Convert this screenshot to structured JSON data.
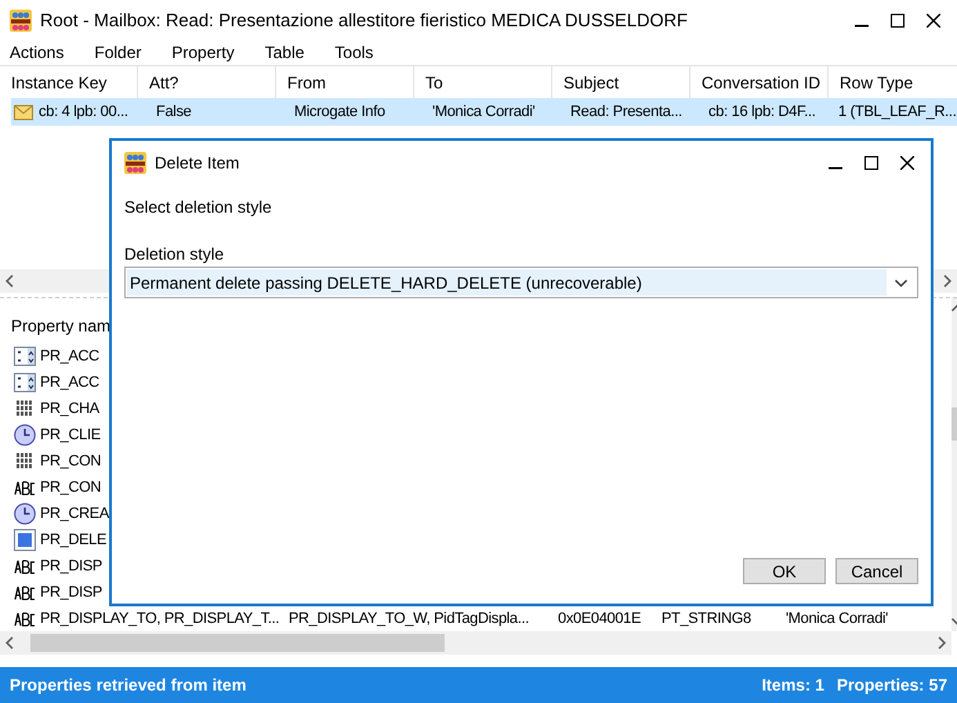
{
  "window": {
    "title": "Root - Mailbox: Read: Presentazione allestitore fieristico MEDICA DUSSELDORF"
  },
  "menu": [
    "Actions",
    "Folder",
    "Property",
    "Table",
    "Tools"
  ],
  "table": {
    "columns": [
      "Instance Key",
      "Att?",
      "From",
      "To",
      "Subject",
      "Conversation ID",
      "Row Type"
    ],
    "rows": [
      {
        "selected": true,
        "cells": [
          "cb: 4 lpb: 00...",
          "False",
          "Microgate Info",
          "'Monica Corradi'",
          "Read: Presenta...",
          "cb: 16 lpb: D4F...",
          "1 (TBL_LEAF_R..."
        ]
      }
    ]
  },
  "properties": {
    "columns": [
      "Property nam"
    ],
    "rows": [
      {
        "kind": "number",
        "cells": [
          "PR_ACC"
        ]
      },
      {
        "kind": "number",
        "cells": [
          "PR_ACC"
        ]
      },
      {
        "kind": "binary",
        "cells": [
          "PR_CHA"
        ]
      },
      {
        "kind": "time",
        "cells": [
          "PR_CLIE"
        ]
      },
      {
        "kind": "binary",
        "cells": [
          "PR_CON"
        ]
      },
      {
        "kind": "string",
        "cells": [
          "PR_CON"
        ]
      },
      {
        "kind": "time",
        "cells": [
          "PR_CREA"
        ]
      },
      {
        "kind": "bool",
        "cells": [
          "PR_DELE"
        ]
      },
      {
        "kind": "string",
        "cells": [
          "PR_DISP"
        ]
      },
      {
        "kind": "string",
        "cells": [
          "PR_DISP"
        ]
      },
      {
        "kind": "string",
        "cells": [
          "PR_DISPLAY_TO, PR_DISPLAY_T...",
          "PR_DISPLAY_TO_W, PidTagDispla...",
          "0x0E04001E",
          "PT_STRING8",
          "'Monica Corradi'"
        ]
      }
    ]
  },
  "status_bar": {
    "message": "Properties retrieved from item",
    "items": "Items: 1",
    "properties": "Properties: 57"
  },
  "dialog": {
    "title": "Delete Item",
    "prompt": "Select deletion style",
    "field_label": "Deletion style",
    "value": "Permanent delete passing DELETE_HARD_DELETE (unrecoverable)",
    "buttons": [
      "OK",
      "Cancel"
    ]
  }
}
